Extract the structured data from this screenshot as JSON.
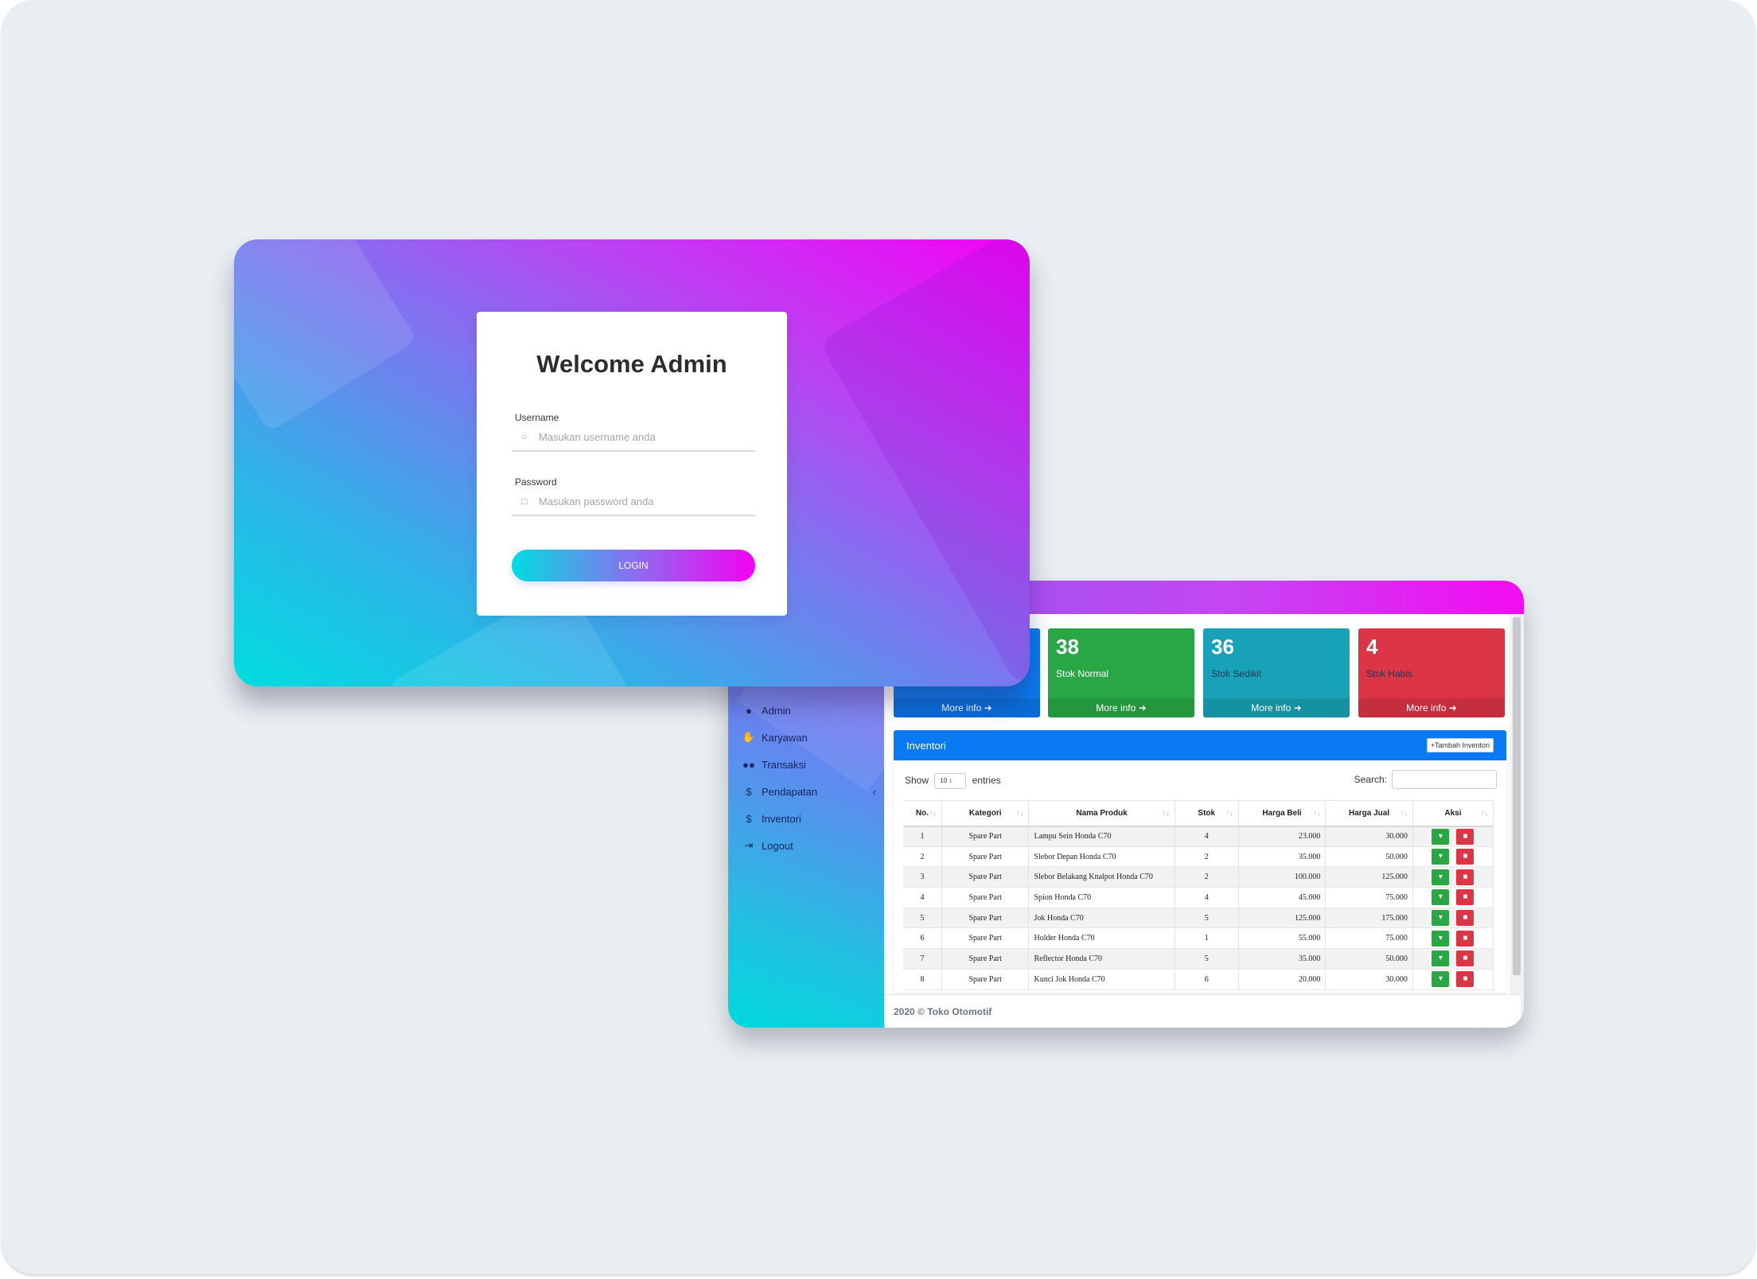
{
  "login": {
    "title": "Welcome Admin",
    "username_label": "Username",
    "username_placeholder": "Masukan username anda",
    "password_label": "Password",
    "password_placeholder": "Masukan password anda",
    "login_button": "LOGIN"
  },
  "sidebar": {
    "items": [
      {
        "label": "Admin",
        "icon": "user-icon"
      },
      {
        "label": "Karyawan",
        "icon": "handshake-icon"
      },
      {
        "label": "Transaksi",
        "icon": "users-icon"
      },
      {
        "label": "Pendapatan",
        "icon": "dollar-icon"
      },
      {
        "label": "Inventori",
        "icon": "dollar-icon"
      },
      {
        "label": "Logout",
        "icon": "logout-icon"
      }
    ]
  },
  "cards": [
    {
      "value": "38",
      "label": "Stok Normal",
      "more": "More info",
      "color": "#29a745"
    },
    {
      "value": "36",
      "label": "Stok Sedikit",
      "more": "More info",
      "color": "#18a2b7"
    },
    {
      "value": "4",
      "label": "Stok Habis",
      "more": "More info",
      "color": "#dc3545"
    }
  ],
  "first_card_more": "More info",
  "inventory": {
    "title": "Inventori",
    "add_button": "+Tambah Inventori",
    "show_label": "Show",
    "entries_value": "10",
    "entries_label": "entries",
    "search_label": "Search:",
    "columns": [
      "No.",
      "Kategori",
      "Nama Produk",
      "Stok",
      "Harga Beli",
      "Harga Jual",
      "Aksi"
    ],
    "rows": [
      [
        "1",
        "Spare Part",
        "Lampu Sein Honda C70",
        "4",
        "23.000",
        "30.000"
      ],
      [
        "2",
        "Spare Part",
        "Slebor Depan Honda C70",
        "2",
        "35.000",
        "50.000"
      ],
      [
        "3",
        "Spare Part",
        "Slebor Belakang Knalpot Honda C70",
        "2",
        "100.000",
        "125.000"
      ],
      [
        "4",
        "Spare Part",
        "Spion Honda C70",
        "4",
        "45.000",
        "75.000"
      ],
      [
        "5",
        "Spare Part",
        "Jok Honda C70",
        "5",
        "125.000",
        "175.000"
      ],
      [
        "6",
        "Spare Part",
        "Holder Honda C70",
        "1",
        "55.000",
        "75.000"
      ],
      [
        "7",
        "Spare Part",
        "Reflector Honda C70",
        "5",
        "35.000",
        "50.000"
      ],
      [
        "8",
        "Spare Part",
        "Kunci Jok Honda C70",
        "6",
        "20.000",
        "30.000"
      ]
    ]
  },
  "footer": "2020 © Toko Otomotif",
  "colors": {
    "primary_blue": "#0a7af3",
    "success_green": "#29a745",
    "info_teal": "#18a2b7",
    "danger_red": "#dc3545",
    "gradient_cyan": "#00dde0",
    "gradient_magenta": "#f401f4"
  }
}
